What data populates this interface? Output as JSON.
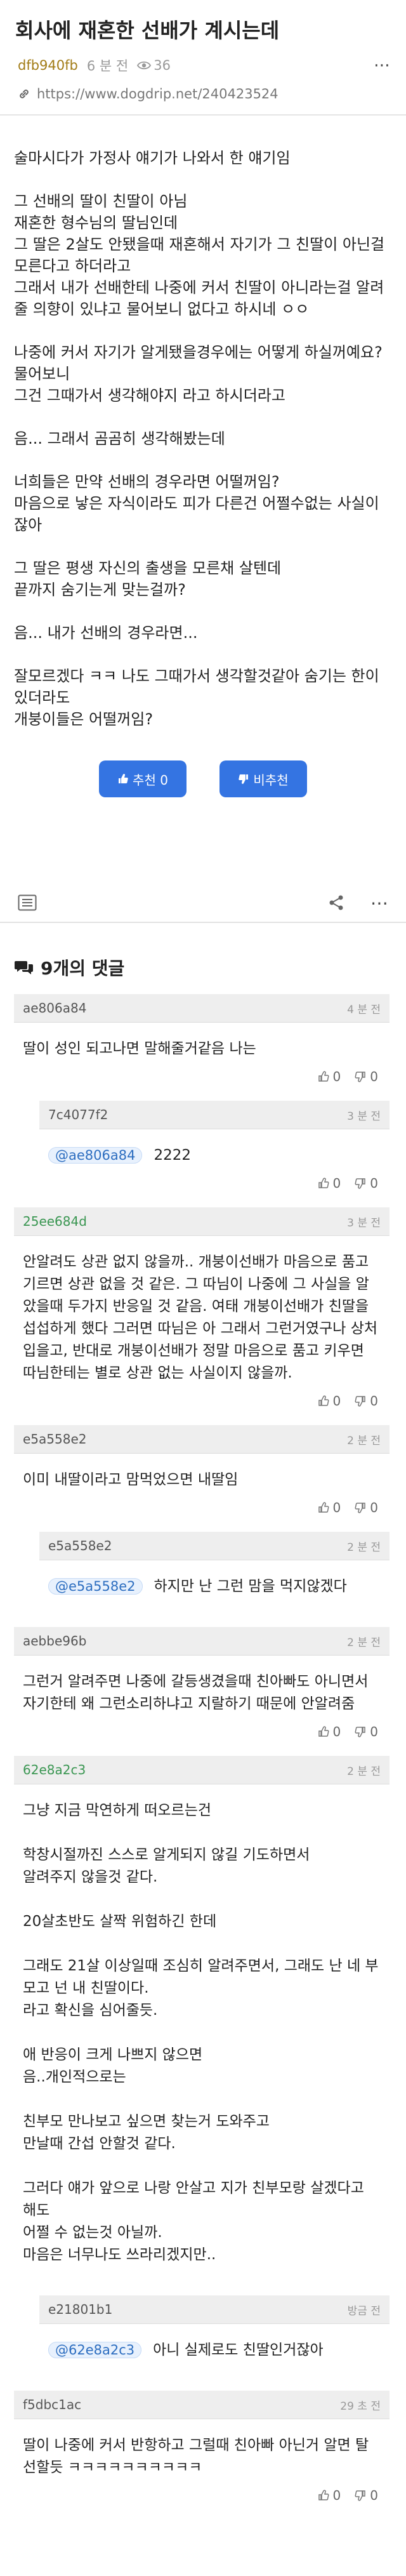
{
  "post": {
    "title": "회사에 재혼한 선배가 계시는데",
    "author": "dfb940fb",
    "time": "6 분 전",
    "views": "36",
    "url": "https://www.dogdrip.net/240423524",
    "paragraphs": [
      "술마시다가 가정사 얘기가 나와서 한 얘기임",
      "그 선배의 딸이 친딸이 아님\n재혼한 형수님의 딸님인데\n그 딸은 2살도 안됐을때 재혼해서 자기가 그 친딸이 아닌걸 모른다고 하더라고\n그래서 내가 선배한테 나중에 커서 친딸이 아니라는걸 알려줄 의향이 있냐고 물어보니 없다고 하시네 ㅇㅇ",
      "나중에 커서 자기가 알게됐을경우에는 어떻게 하실꺼예요? 물어보니\n그건 그때가서 생각해야지 라고 하시더라고",
      "음... 그래서 곰곰히 생각해봤는데",
      "너희들은 만약 선배의 경우라면 어떨꺼임?\n마음으로 낳은 자식이라도 피가 다른건 어쩔수없는 사실이잖아",
      "그 딸은 평생 자신의 출생을 모른채 살텐데\n끝까지 숨기는게 맞는걸까?",
      "음... 내가 선배의 경우라면...",
      "잘모르겠다 ㅋㅋ 나도 그때가서 생각할것같아 숨기는 한이 있더라도\n개붕이들은 어떨꺼임?"
    ],
    "upvote_label": "추천 0",
    "downvote_label": "비추천"
  },
  "comments_title": "9개의 댓글",
  "comments": [
    {
      "author": "ae806a84",
      "time": "4 분 전",
      "mention": "",
      "text": "딸이 성인 되고나면 말해줄거같음 나는",
      "up": "0",
      "down": "0",
      "reply": false,
      "green": false
    },
    {
      "author": "7c4077f2",
      "time": "3 분 전",
      "mention": "@ae806a84",
      "text": "2222",
      "up": "0",
      "down": "0",
      "reply": true,
      "green": false
    },
    {
      "author": "25ee684d",
      "time": "3 분 전",
      "mention": "",
      "text": "안알려도 상관 없지 않을까.. 개붕이선배가 마음으로 품고 기르면 상관 없을 것 같은. 그 따님이 나중에 그 사실을 알았을때 두가지 반응일 것 같음. 여태 개붕이선배가 친딸을 섭섭하게 했다 그러면 따님은 아 그래서 그런거였구나 상처입을고, 반대로 개붕이선배가 정말 마음으로 품고 키우면 따님한테는 별로 상관 없는 사실이지 않을까.",
      "up": "0",
      "down": "0",
      "reply": false,
      "green": true
    },
    {
      "author": "e5a558e2",
      "time": "2 분 전",
      "mention": "",
      "text": "이미 내딸이라고 맘먹었으면 내딸임",
      "up": "0",
      "down": "0",
      "reply": false,
      "green": false
    },
    {
      "author": "e5a558e2",
      "time": "2 분 전",
      "mention": "@e5a558e2",
      "text": "하지만 난 그런 맘을 먹지않겠다",
      "up": "",
      "down": "",
      "reply": true,
      "green": false
    },
    {
      "author": "aebbe96b",
      "time": "2 분 전",
      "mention": "",
      "text": "그런거 알려주면 나중에 갈등생겼을때 친아빠도 아니면서 자기한테 왜 그런소리하냐고 지랄하기 때문에 안알려줌",
      "up": "0",
      "down": "0",
      "reply": false,
      "green": false
    },
    {
      "author": "62e8a2c3",
      "time": "2 분 전",
      "mention": "",
      "text": "그냥 지금 막연하게 떠오르는건\n\n학창시절까진 스스로 알게되지 않길 기도하면서\n알려주지 않을것 같다.\n\n20살초반도 살짝 위험하긴 한데\n\n그래도 21살 이상일때 조심히 알려주면서, 그래도 난 네 부모고 넌 내 친딸이다.\n라고 확신을 심어줄듯.\n\n애 반응이 크게 나쁘지 않으면\n음..개인적으로는\n\n친부모 만나보고 싶으면 찾는거 도와주고\n만날때 간섭 안할것 같다.\n\n그러다 얘가 앞으로 나랑 안살고 지가 친부모랑 살겠다고 해도\n어쩔 수 없는것 아닐까.\n마음은 너무나도 쓰라리겠지만..",
      "up": "",
      "down": "",
      "reply": false,
      "green": true
    },
    {
      "author": "e21801b1",
      "time": "방금 전",
      "mention": "@62e8a2c3",
      "text": "아니 실제로도 친딸인거잖아",
      "up": "",
      "down": "",
      "reply": true,
      "green": false
    },
    {
      "author": "f5dbc1ac",
      "time": "29 초 전",
      "mention": "",
      "text": "딸이 나중에 커서 반항하고 그럴때 친아빠 아닌거 알면 탈선할듯 ㅋㅋㅋㅋㅋㅋㅋㅋㅋㅋ",
      "up": "0",
      "down": "0",
      "reply": false,
      "green": false
    }
  ],
  "icons": {
    "eye": "eye-icon",
    "link": "link-icon",
    "more": "more-dots-icon",
    "thumb_up": "thumb-up-icon",
    "thumb_down": "thumb-down-icon",
    "list": "list-icon",
    "share": "share-icon",
    "comment": "comment-bubble-icon"
  },
  "colors": {
    "accent": "#3474e2",
    "author": "#a27c16",
    "comment_head": "#eeeeee",
    "green_author": "#3a9652"
  }
}
